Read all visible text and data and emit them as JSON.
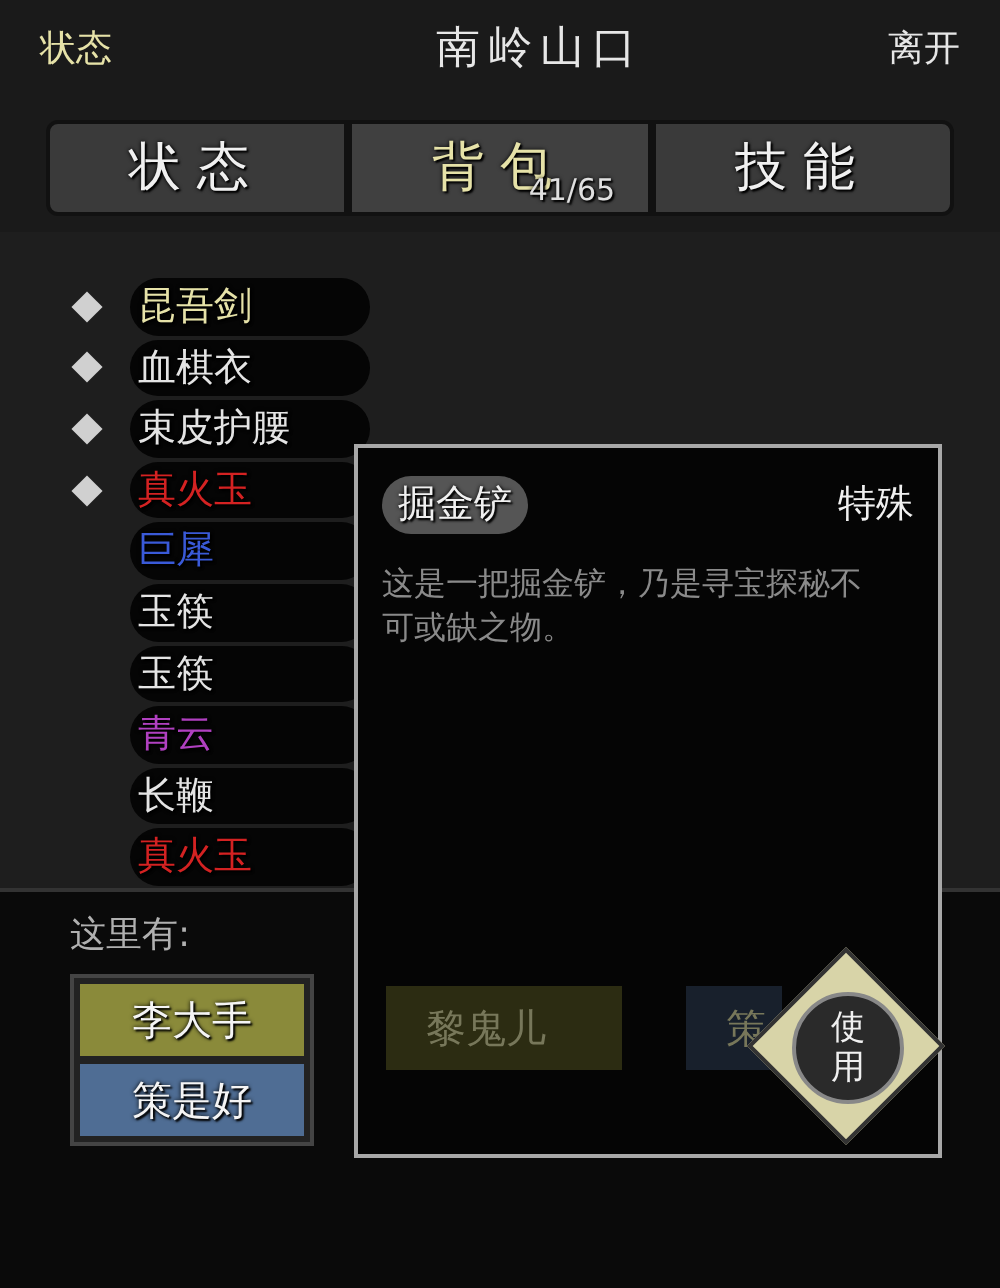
{
  "header": {
    "left": "状态",
    "title": "南岭山口",
    "right": "离开"
  },
  "tabs": [
    {
      "label": "状态",
      "selected": false
    },
    {
      "label": "背包",
      "selected": true,
      "count": "41/65"
    },
    {
      "label": "技能",
      "selected": false
    }
  ],
  "items": [
    {
      "name": "昆吾剑",
      "color": "#e6e2a8",
      "equipped": true
    },
    {
      "name": "血棋衣",
      "color": "#e4e4e4",
      "equipped": true
    },
    {
      "name": "束皮护腰",
      "color": "#e4e4e4",
      "equipped": true
    },
    {
      "name": "真火玉",
      "color": "#d42222",
      "equipped": true
    },
    {
      "name": "巨犀",
      "color": "#3a5ad8",
      "equipped": false
    },
    {
      "name": "玉筷",
      "color": "#e4e4e4",
      "equipped": false
    },
    {
      "name": "玉筷",
      "color": "#e4e4e4",
      "equipped": false
    },
    {
      "name": "青云",
      "color": "#b040c0",
      "equipped": false
    },
    {
      "name": "长鞭",
      "color": "#e4e4e4",
      "equipped": false
    },
    {
      "name": "真火玉",
      "color": "#d42222",
      "equipped": false
    }
  ],
  "here": {
    "label": "这里有:",
    "people": [
      {
        "name": "李大手",
        "color": "#8a8a3a"
      },
      {
        "name": "策是好",
        "color": "#4f6d94"
      }
    ]
  },
  "popup": {
    "name": "掘金铲",
    "type": "特殊",
    "description": "这是一把掘金铲，乃是寻宝探秘不可或缺之物。",
    "behind": [
      {
        "name": "黎鬼儿",
        "color": "#2c2c12"
      },
      {
        "name": "策",
        "color": "#18202c"
      }
    ],
    "action": "使用"
  }
}
